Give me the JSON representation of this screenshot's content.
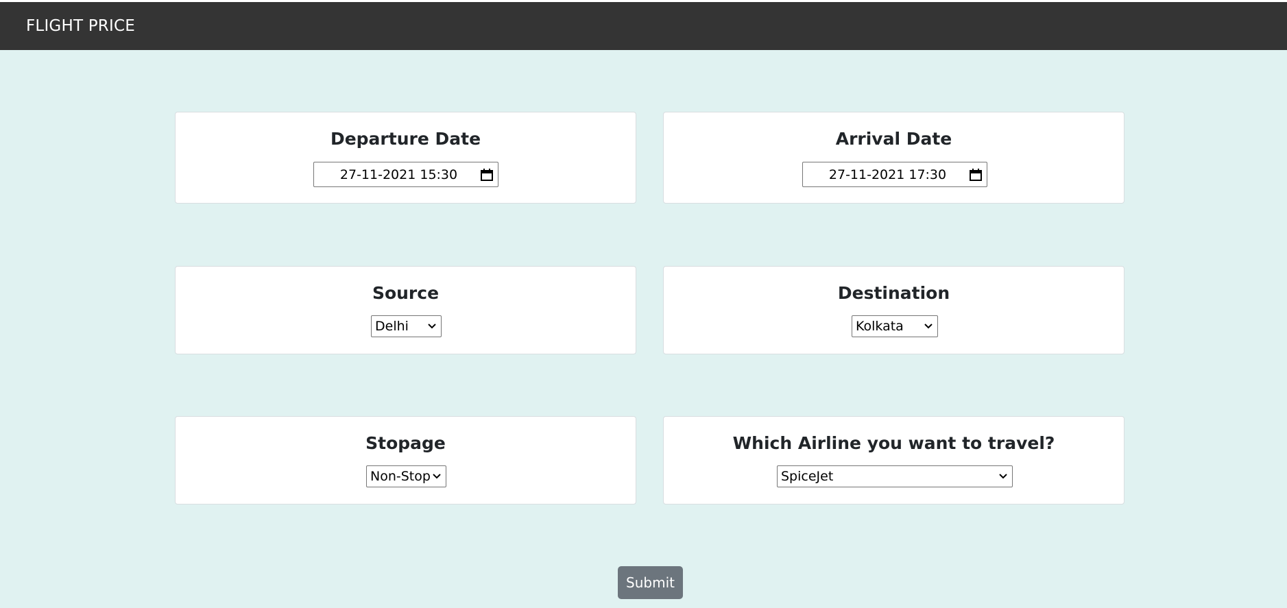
{
  "navbar": {
    "brand": "FLIGHT PRICE"
  },
  "form": {
    "departure": {
      "label": "Departure Date",
      "value": "27-11-2021 15:30",
      "icon": "calendar-icon"
    },
    "arrival": {
      "label": "Arrival Date",
      "value": "27-11-2021 17:30",
      "icon": "calendar-icon"
    },
    "source": {
      "label": "Source",
      "selected": "Delhi",
      "icon": "chevron-down-icon"
    },
    "destination": {
      "label": "Destination",
      "selected": "Kolkata",
      "icon": "chevron-down-icon"
    },
    "stopage": {
      "label": "Stopage",
      "selected": "Non-Stop",
      "icon": "chevron-down-icon"
    },
    "airline": {
      "label": "Which Airline you want to travel?",
      "selected": "SpiceJet",
      "icon": "chevron-down-icon"
    },
    "submit_label": "Submit"
  },
  "colors": {
    "navbar_bg": "#343434",
    "page_bg": "#e0f2f1",
    "card_bg": "#ffffff",
    "button_bg": "#6c757d"
  }
}
